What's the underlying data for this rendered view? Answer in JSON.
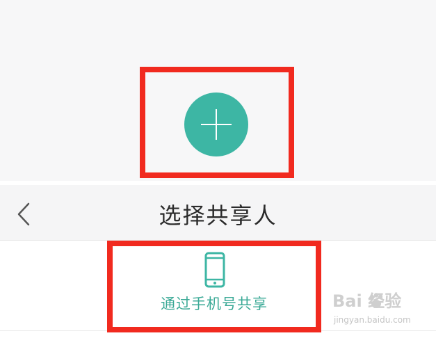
{
  "top_screen": {
    "add_button_icon": "plus-icon"
  },
  "share_screen": {
    "nav": {
      "back_icon": "chevron-left-icon",
      "title": "选择共享人"
    },
    "share_option": {
      "icon": "smartphone-icon",
      "label": "通过手机号共享"
    }
  },
  "annotations": {
    "highlight_color": "#f12a1f"
  },
  "watermark": {
    "brand": "Bai 经验",
    "url": "jingyan.baidu.com"
  },
  "colors": {
    "accent": "#3db6a4",
    "label_text": "#3aa996",
    "title_text": "#2b2b2b"
  }
}
